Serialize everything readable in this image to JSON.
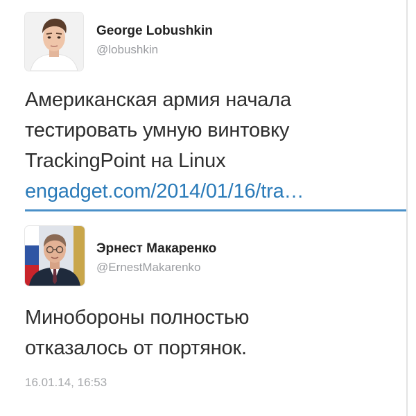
{
  "tweets": [
    {
      "author_name": "George Lobushkin",
      "author_handle": "@lobushkin",
      "avatar_icon": "young-man-portrait-photo",
      "text_lines": [
        "Американская армия начала",
        "тестировать умную винтовку",
        "TrackingPoint на Linux"
      ],
      "link": "engadget.com/2014/01/16/tra…"
    },
    {
      "author_name": "Эрнест Макаренко",
      "author_handle": "@ErnestMakarenko",
      "avatar_icon": "official-portrait-with-flags-photo",
      "text_lines": [
        "Минобороны полностью",
        "отказалось от портянок."
      ],
      "timestamp": "16.01.14, 16:53"
    }
  ],
  "colors": {
    "link": "#2b7bb9",
    "divider": "#4a90c8",
    "secondary_text": "#9a9ca0"
  }
}
